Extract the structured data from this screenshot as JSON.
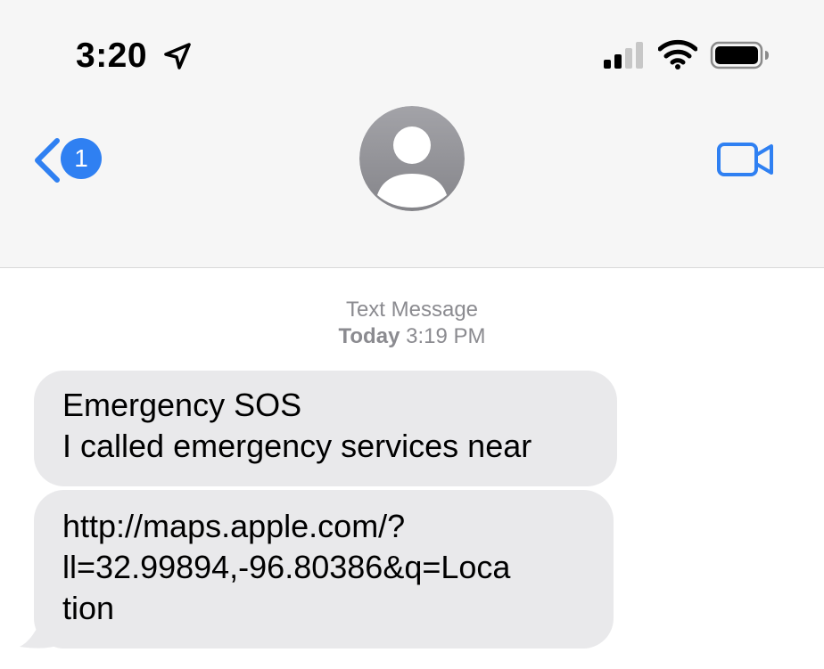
{
  "status_bar": {
    "time": "3:20",
    "location_icon": "location-arrow-icon",
    "signal_icon": "cellular-signal-icon",
    "wifi_icon": "wifi-icon",
    "battery_icon": "battery-icon"
  },
  "nav": {
    "back_icon": "chevron-left-icon",
    "unread_count": "1",
    "avatar_icon": "person-silhouette-icon",
    "video_icon": "video-camera-icon"
  },
  "conversation": {
    "service_label": "Text Message",
    "day_label": "Today",
    "time_label": "3:19 PM",
    "messages": [
      {
        "lines": [
          "Emergency SOS",
          "I called emergency services near"
        ]
      },
      {
        "lines": [
          "http://maps.apple.com/?",
          "ll=32.99894,-96.80386&q=Loca",
          "tion"
        ]
      }
    ]
  },
  "colors": {
    "accent": "#2f80f2",
    "header_bg": "#f6f6f6",
    "bubble_bg": "#e9e9eb",
    "timestamp_text": "#8b8b90",
    "avatar_bg": "#8e8e93"
  }
}
